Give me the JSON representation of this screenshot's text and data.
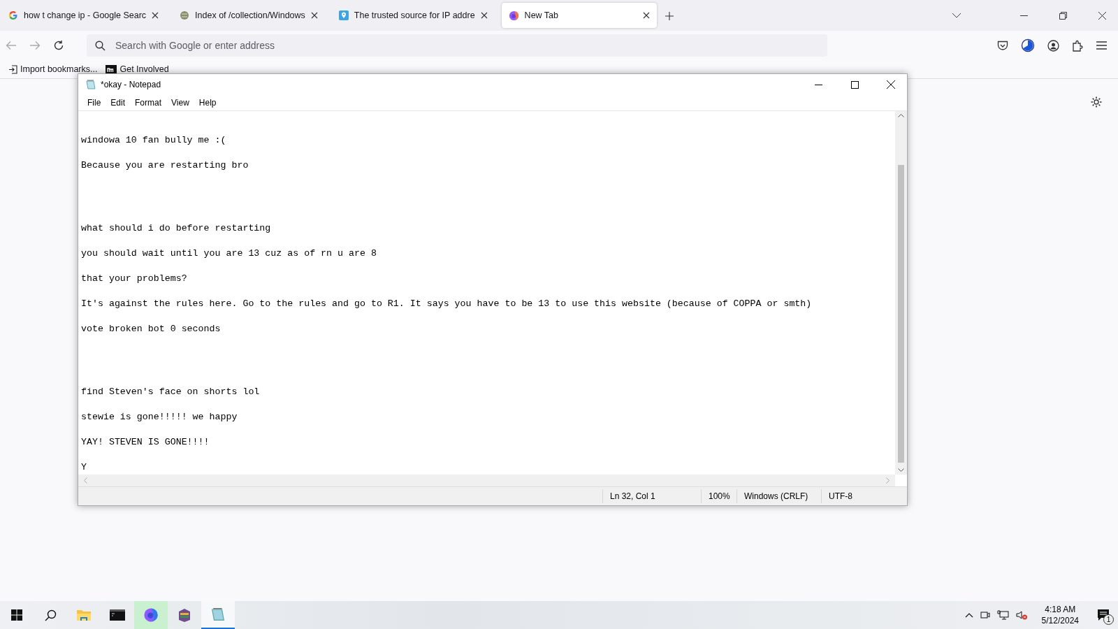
{
  "browser": {
    "tabs": [
      {
        "title": "how t change ip - Google Searc",
        "kind": "google",
        "selected": false
      },
      {
        "title": "Index of /collection/Windows",
        "kind": "archive",
        "selected": false
      },
      {
        "title": "The trusted source for IP addre",
        "kind": "location",
        "selected": false
      },
      {
        "title": "New Tab",
        "kind": "firefox",
        "selected": true
      }
    ],
    "address_bar": {
      "placeholder": "Search with Google or enter address"
    },
    "bookmarks": [
      {
        "label": "Import bookmarks...",
        "kind": "import"
      },
      {
        "label": "Get Involved",
        "kind": "m"
      }
    ]
  },
  "notepad": {
    "title": "*okay - Notepad",
    "menu": [
      "File",
      "Edit",
      "Format",
      "View",
      "Help"
    ],
    "text": "\n\nwindowa 10 fan bully me :(\n\nBecause you are restarting bro\n\n\n\n\nwhat should i do before restarting\n\nyou should wait until you are 13 cuz as of rn u are 8\n\nthat your problems?\n\nIt's against the rules here. Go to the rules and go to R1. It says you have to be 13 to use this website (because of COPPA or smth)\n\nvote broken bot 0 seconds\n\n\n\n\nfind Steven's face on shorts lol\n\nstewie is gone!!!!! we happy\n\nYAY! STEVEN IS GONE!!!!\n\nY",
    "status_bar": {
      "position": "Ln 32, Col 1",
      "zoom": "100%",
      "line_ending": "Windows (CRLF)",
      "encoding": "UTF-8"
    }
  },
  "taskbar": {
    "apps": [
      {
        "kind": "explorer",
        "selected": false,
        "hovered": false
      },
      {
        "kind": "terminal",
        "selected": false,
        "hovered": false
      },
      {
        "kind": "firefox",
        "selected": false,
        "hovered": true
      },
      {
        "kind": "archive",
        "selected": false,
        "hovered": false
      },
      {
        "kind": "notepad",
        "selected": true,
        "hovered": false
      }
    ],
    "clock": {
      "time": "4:18 AM",
      "date": "5/12/2024"
    },
    "notification_count": "1"
  }
}
